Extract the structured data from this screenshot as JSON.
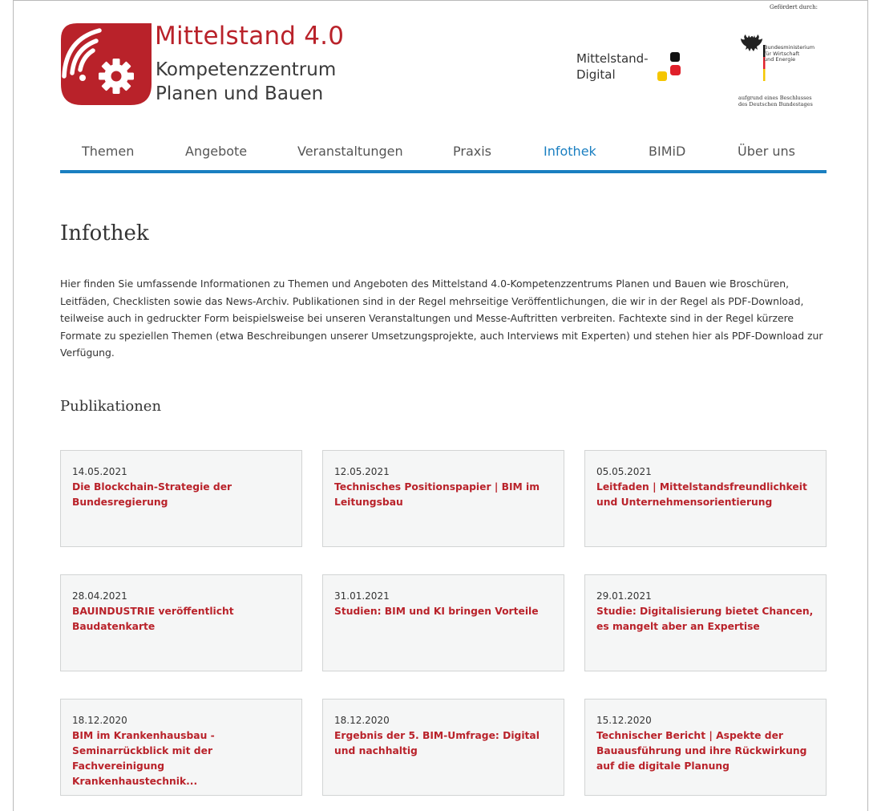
{
  "header": {
    "brand_title": "Mittelstand 4.0",
    "brand_sub_line1": "Kompetenzzentrum",
    "brand_sub_line2": "Planen und Bauen",
    "md_line1": "Mittelstand-",
    "md_line2": "Digital",
    "funded_by": "Gefördert durch:",
    "ministry_line1": "Bundesministerium",
    "ministry_line2": "für Wirtschaft",
    "ministry_line3": "und Energie",
    "resolution_line1": "aufgrund eines Beschlusses",
    "resolution_line2": "des Deutschen Bundestages"
  },
  "nav": {
    "items": [
      {
        "label": "Themen"
      },
      {
        "label": "Angebote"
      },
      {
        "label": "Veranstaltungen"
      },
      {
        "label": "Praxis"
      },
      {
        "label": "Infothek"
      },
      {
        "label": "BIMiD"
      },
      {
        "label": "Über uns"
      }
    ],
    "active": "Infothek"
  },
  "main": {
    "title": "Infothek",
    "intro": "Hier finden Sie umfassende Informationen zu Themen und Angeboten des Mittelstand 4.0-Kompetenzzentrums Planen und Bauen wie Broschüren, Leitfäden, Checklisten sowie das News-Archiv. Publikationen sind in der Regel mehrseitige Veröffentlichungen, die wir in der Regel als PDF-Download, teilweise auch in gedruckter Form beispielsweise bei unseren Veranstaltungen und Messe-Auftritten verbreiten. Fachtexte sind in der Regel kürzere Formate zu speziellen Themen (etwa Beschreibungen unserer Umsetzungsprojekte, auch Interviews mit Experten) und stehen hier als PDF-Download zur Verfügung.",
    "section_title": "Publikationen",
    "cards": [
      {
        "date": "14.05.2021",
        "title": "Die Blockchain-Strategie der Bundesregierung"
      },
      {
        "date": "12.05.2021",
        "title": "Technisches Positionspapier | BIM im Leitungsbau"
      },
      {
        "date": "05.05.2021",
        "title": "Leitfaden | Mittelstandsfreundlichkeit und Unternehmensorientierung"
      },
      {
        "date": "28.04.2021",
        "title": "BAUINDUSTRIE veröffentlicht Baudatenkarte"
      },
      {
        "date": "31.01.2021",
        "title": "Studien: BIM und KI bringen Vorteile"
      },
      {
        "date": "29.01.2021",
        "title": "Studie: Digitalisierung bietet Chancen, es mangelt aber an Expertise"
      },
      {
        "date": "18.12.2020",
        "title": "BIM im Krankenhausbau - Seminarrückblick mit der Fachvereinigung Krankenhaustechnik..."
      },
      {
        "date": "18.12.2020",
        "title": "Ergebnis der 5. BIM-Umfrage: Digital und nachhaltig"
      },
      {
        "date": "15.12.2020",
        "title": "Technischer Bericht | Aspekte der Bauausführung und ihre Rückwirkung auf die digitale Planung"
      }
    ]
  },
  "colors": {
    "brand_red": "#b9222a",
    "nav_blue": "#1a7fc1",
    "card_bg": "#f5f6f6",
    "card_border": "#d2d4d4"
  }
}
